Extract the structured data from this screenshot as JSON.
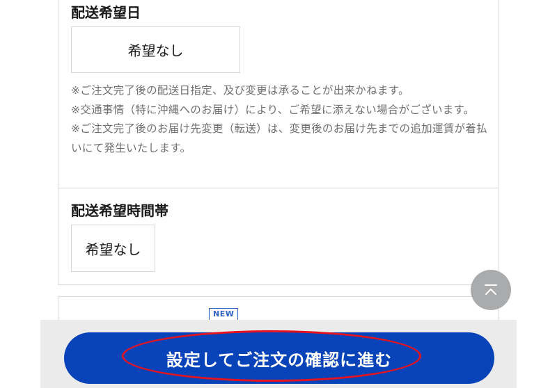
{
  "delivery_date": {
    "title": "配送希望日",
    "selected_value": "希望なし",
    "notes": "※ご注文完了後の配送日指定、及び変更は承ることが出来かねます。\n※交通事情（特に沖縄へのお届け）により、ご希望に添えない場合がございます。\n※ご注文完了後のお届け先変更（転送）は、変更後のお届け先までの追加運賃が着払いにて発生いたします。"
  },
  "delivery_time": {
    "title": "配送希望時間帯",
    "selected_value": "希望なし"
  },
  "next_section": {
    "badge": "NEW"
  },
  "footer": {
    "confirm_button_label": "設定してご注文の確認に進む"
  },
  "icons": {
    "scroll_top": "arrow-up-to-top-icon"
  },
  "colors": {
    "primary_button": "#0943b9",
    "highlight": "#e3141f",
    "badge": "#2f62c8",
    "scroll_button": "#a9abad"
  }
}
